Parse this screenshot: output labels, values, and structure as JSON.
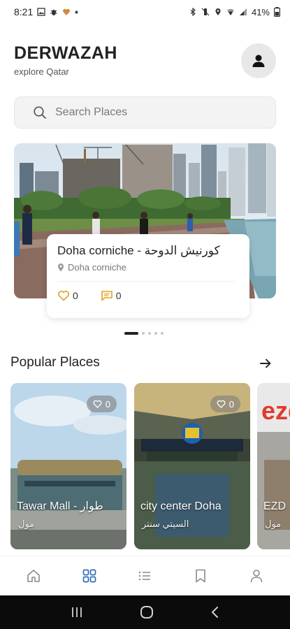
{
  "status_bar": {
    "time": "8:21",
    "battery": "41%",
    "icons_left": [
      "gallery-icon",
      "bug-icon",
      "heart-icon",
      "dot-icon"
    ],
    "icons_right": [
      "bluetooth-icon",
      "mute-icon",
      "location-icon",
      "wifi-icon",
      "signal-icon",
      "battery-icon"
    ]
  },
  "header": {
    "brand": "DERWAZAH",
    "tagline": "explore Qatar",
    "profile_icon": "user-icon"
  },
  "search": {
    "placeholder": "Search Places",
    "icon": "search-icon"
  },
  "featured": {
    "title": "Doha corniche - كورنيش الدوحة",
    "location": "Doha corniche",
    "likes": "0",
    "comments": "0",
    "carousel_pages": 5,
    "carousel_active": 1
  },
  "popular": {
    "title": "Popular Places",
    "items": [
      {
        "name": "Tawar Mall - طوار",
        "subtitle": "مول",
        "likes": "0"
      },
      {
        "name": "city center Doha",
        "subtitle": "السيتي سنتر",
        "likes": "0"
      },
      {
        "name": "EZD",
        "subtitle": "مول",
        "likes": ""
      }
    ]
  },
  "bottom_nav": {
    "items": [
      "home-icon",
      "grid-icon",
      "list-icon",
      "bookmark-icon",
      "profile-icon"
    ],
    "active": "grid-icon",
    "active_color": "#2f6fb5"
  },
  "colors": {
    "accent": "#2f6fb5",
    "heart": "#e0a020",
    "comment": "#e0a020"
  }
}
